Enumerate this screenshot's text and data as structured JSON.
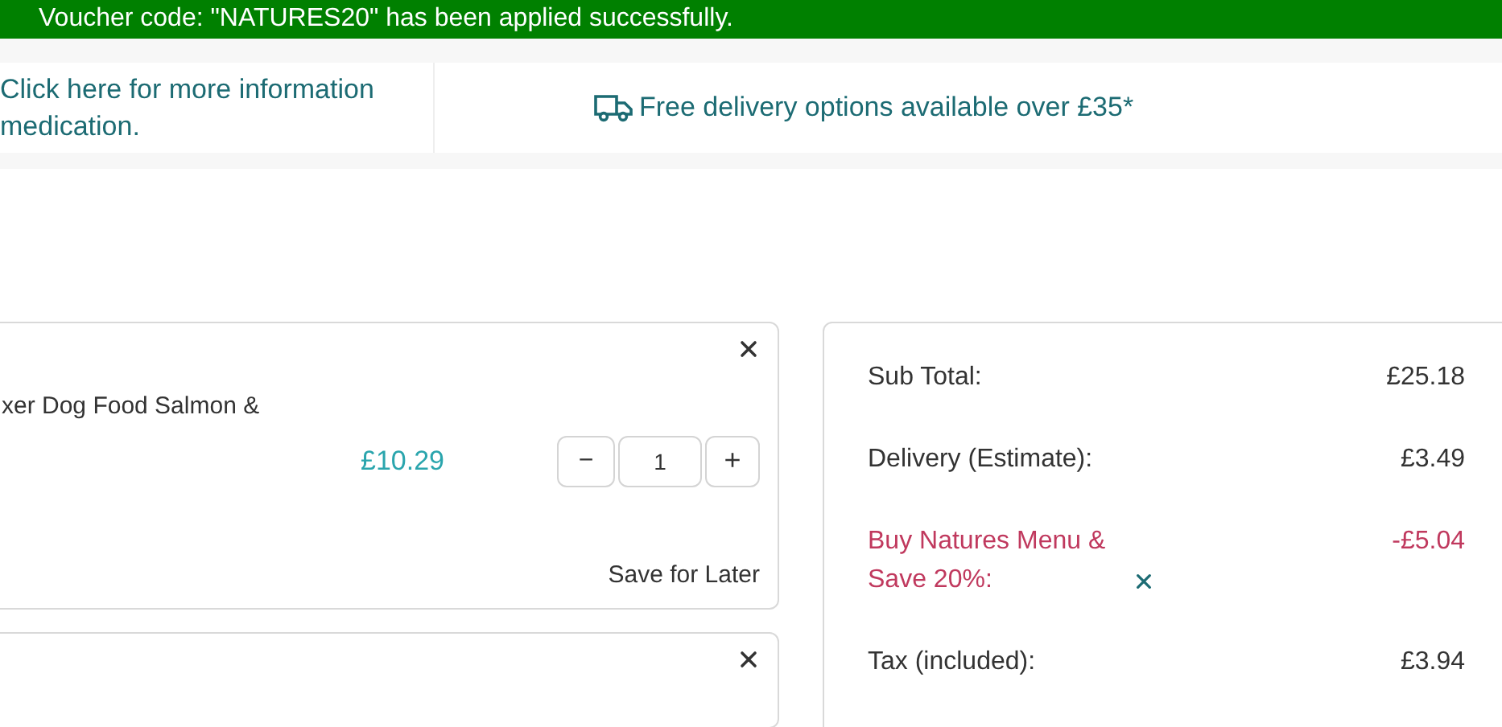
{
  "alert": {
    "message": "Voucher code: \"NATURES20\" has been applied successfully."
  },
  "info_bar": {
    "notice_lines": [
      "Click here for more information",
      "medication."
    ],
    "delivery": "Free delivery options available over £35*"
  },
  "cart_items": [
    {
      "kind": "full",
      "name": "xer Dog Food Salmon &",
      "price": "£10.29",
      "quantity": "1",
      "minus": "−",
      "plus": "+",
      "save_link": "Save for Later"
    },
    {
      "kind": "cut_off"
    }
  ],
  "summary": {
    "rows": [
      {
        "kind": "plain",
        "label": "Sub Total:",
        "value": "£25.18"
      },
      {
        "kind": "plain",
        "label": "Delivery (Estimate):",
        "value": "£3.49"
      },
      {
        "kind": "discount",
        "label": "Buy Natures Menu & Save 20%:",
        "value": "-£5.04"
      },
      {
        "kind": "plain",
        "label": "Tax (included):",
        "value": "£3.94"
      }
    ]
  }
}
